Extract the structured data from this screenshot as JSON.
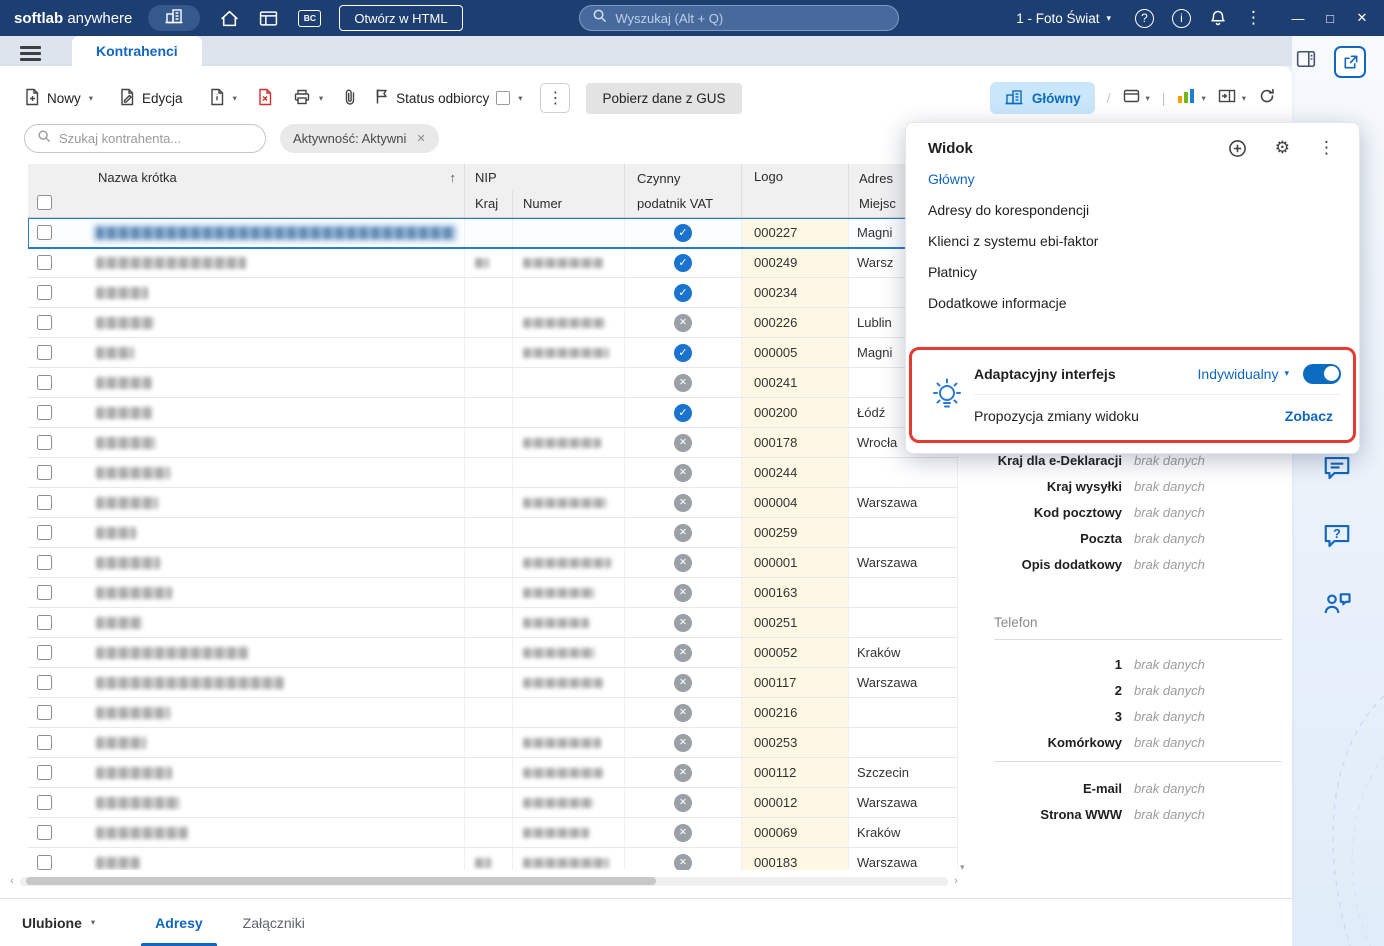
{
  "topbar": {
    "brand_softlab": "softlab",
    "brand_anywhere": " anywhere",
    "bc": "BC",
    "open_html": "Otwórz w HTML",
    "search_placeholder": "Wyszukaj (Alt + Q)",
    "company": "1 - Foto Świat"
  },
  "tabbar": {
    "kontrahenci": "Kontrahenci"
  },
  "toolbar": {
    "nowy": "Nowy",
    "edycja": "Edycja",
    "status_odbiorcy": "Status odbiorcy",
    "gus": "Pobierz dane z GUS",
    "glowny": "Główny"
  },
  "filterbar": {
    "search_placeholder": "Szukaj kontrahenta...",
    "chip": "Aktywność: Aktywni"
  },
  "table": {
    "headers": {
      "name": "Nazwa krótka",
      "nip": "NIP",
      "kraj": "Kraj",
      "numer": "Numer",
      "vat_line1": "Czynny",
      "vat_line2": "podatnik VAT",
      "logo": "Logo",
      "adres": "Adres",
      "miejsc": "Miejsc"
    },
    "rows": [
      {
        "selected": true,
        "name_w": 358,
        "kraj_w": 0,
        "nip_w": 0,
        "vat": true,
        "logo": "000227",
        "city": "Magni"
      },
      {
        "name_w": 150,
        "kraj_w": 14,
        "nip_w": 80,
        "vat": true,
        "logo": "000249",
        "city": "Warsz"
      },
      {
        "name_w": 52,
        "kraj_w": 0,
        "nip_w": 0,
        "vat": true,
        "logo": "000234",
        "city": ""
      },
      {
        "name_w": 58,
        "kraj_w": 0,
        "nip_w": 82,
        "vat": false,
        "logo": "000226",
        "city": "Lublin"
      },
      {
        "name_w": 38,
        "kraj_w": 0,
        "nip_w": 86,
        "vat": true,
        "logo": "000005",
        "city": "Magni"
      },
      {
        "name_w": 56,
        "kraj_w": 0,
        "nip_w": 0,
        "vat": false,
        "logo": "000241",
        "city": ""
      },
      {
        "name_w": 56,
        "kraj_w": 0,
        "nip_w": 0,
        "vat": true,
        "logo": "000200",
        "city": "Łódź"
      },
      {
        "name_w": 60,
        "kraj_w": 0,
        "nip_w": 78,
        "vat": false,
        "logo": "000178",
        "city": "Wrocła"
      },
      {
        "name_w": 74,
        "kraj_w": 0,
        "nip_w": 0,
        "vat": false,
        "logo": "000244",
        "city": ""
      },
      {
        "name_w": 62,
        "kraj_w": 0,
        "nip_w": 84,
        "vat": false,
        "logo": "000004",
        "city": "Warszawa"
      },
      {
        "name_w": 40,
        "kraj_w": 0,
        "nip_w": 0,
        "vat": false,
        "logo": "000259",
        "city": ""
      },
      {
        "name_w": 64,
        "kraj_w": 0,
        "nip_w": 88,
        "vat": false,
        "logo": "000001",
        "city": "Warszawa"
      },
      {
        "name_w": 76,
        "kraj_w": 0,
        "nip_w": 72,
        "vat": false,
        "logo": "000163",
        "city": ""
      },
      {
        "name_w": 46,
        "kraj_w": 0,
        "nip_w": 66,
        "vat": false,
        "logo": "000251",
        "city": ""
      },
      {
        "name_w": 152,
        "kraj_w": 0,
        "nip_w": 72,
        "vat": false,
        "logo": "000052",
        "city": "Kraków"
      },
      {
        "name_w": 188,
        "kraj_w": 0,
        "nip_w": 80,
        "vat": false,
        "logo": "000117",
        "city": "Warszawa"
      },
      {
        "name_w": 74,
        "kraj_w": 0,
        "nip_w": 0,
        "vat": false,
        "logo": "000216",
        "city": ""
      },
      {
        "name_w": 50,
        "kraj_w": 0,
        "nip_w": 78,
        "vat": false,
        "logo": "000253",
        "city": ""
      },
      {
        "name_w": 76,
        "kraj_w": 0,
        "nip_w": 80,
        "vat": false,
        "logo": "000112",
        "city": "Szczecin"
      },
      {
        "name_w": 84,
        "kraj_w": 0,
        "nip_w": 70,
        "vat": false,
        "logo": "000012",
        "city": "Warszawa"
      },
      {
        "name_w": 92,
        "kraj_w": 0,
        "nip_w": 66,
        "vat": false,
        "logo": "000069",
        "city": "Kraków"
      },
      {
        "name_w": 44,
        "kraj_w": 16,
        "nip_w": 86,
        "vat": false,
        "logo": "000183",
        "city": "Warszawa"
      }
    ]
  },
  "view_popup": {
    "title": "Widok",
    "items": [
      "Główny",
      "Adresy do korespondencji",
      "Klienci z systemu ebi-faktor",
      "Płatnicy",
      "Dodatkowe informacje"
    ],
    "active_index": 0,
    "adaptive_label": "Adaptacyjny interfejs",
    "adaptive_mode": "Indywidualny",
    "adaptive_on": true,
    "proposal_label": "Propozycja zmiany widoku",
    "see_label": "Zobacz"
  },
  "details": {
    "main_fields": [
      {
        "label": "Kraj dla e-Deklaracji",
        "value": "brak danych"
      },
      {
        "label": "Kraj wysyłki",
        "value": "brak danych"
      },
      {
        "label": "Kod pocztowy",
        "value": "brak danych"
      },
      {
        "label": "Poczta",
        "value": "brak danych"
      },
      {
        "label": "Opis dodatkowy",
        "value": "brak danych"
      }
    ],
    "telefon_heading": "Telefon",
    "phone_fields": [
      {
        "label": "1",
        "value": "brak danych"
      },
      {
        "label": "2",
        "value": "brak danych"
      },
      {
        "label": "3",
        "value": "brak danych"
      },
      {
        "label": "Komórkowy",
        "value": "brak danych"
      }
    ],
    "contact_fields": [
      {
        "label": "E-mail",
        "value": "brak danych"
      },
      {
        "label": "Strona WWW",
        "value": "brak danych"
      }
    ]
  },
  "bottombar": {
    "ulubione": "Ulubione",
    "tabs": [
      "Adresy",
      "Załączniki"
    ],
    "active": 0
  },
  "colors": {
    "topbar": "#1c3e70",
    "accent": "#1166c0",
    "annotation": "#e33a31",
    "logo_column_bg": "#fcf8e3"
  }
}
